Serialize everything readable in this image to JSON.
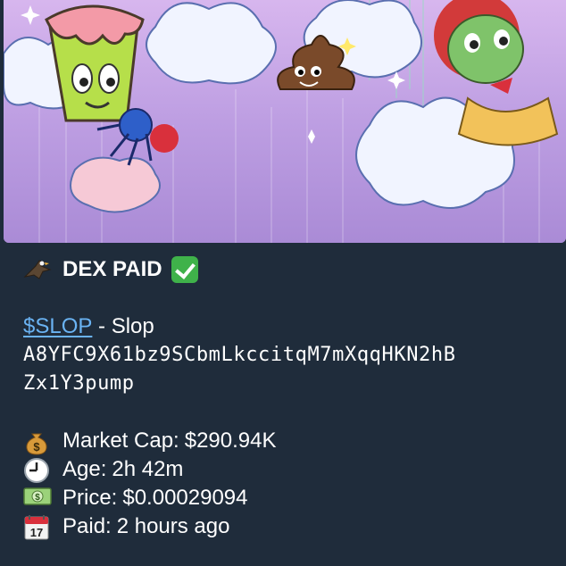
{
  "banner": {
    "image_alt": "Slop meme banner artwork",
    "colors": {
      "sky": "#c4a3e4",
      "cloud": "#f3f6ff"
    }
  },
  "post": {
    "header_icon": "eagle-icon",
    "header_title": "DEX PAID",
    "header_badge_icon": "check-mark-button-icon",
    "ticker": "$SLOP",
    "ticker_separator": " - ",
    "token_name": "Slop",
    "contract_line1": "A8YFC9X61bz9SCbmLkccitqM7mXqqHKN2hB",
    "contract_line2": "Zx1Y3pump",
    "stats": [
      {
        "icon": "money-bag-icon",
        "label": "Market Cap:",
        "value": "$290.94K"
      },
      {
        "icon": "clock-icon",
        "label": "Age:",
        "value": "2h 42m"
      },
      {
        "icon": "dollar-banknote-icon",
        "label": "Price:",
        "value": "$0.00029094"
      },
      {
        "icon": "calendar-icon",
        "label": "Paid:",
        "value": "2 hours ago"
      }
    ]
  },
  "colors": {
    "background": "#1f2c3b",
    "text": "#ffffff",
    "link": "#6ab3f3",
    "check": "#3fb24a"
  }
}
